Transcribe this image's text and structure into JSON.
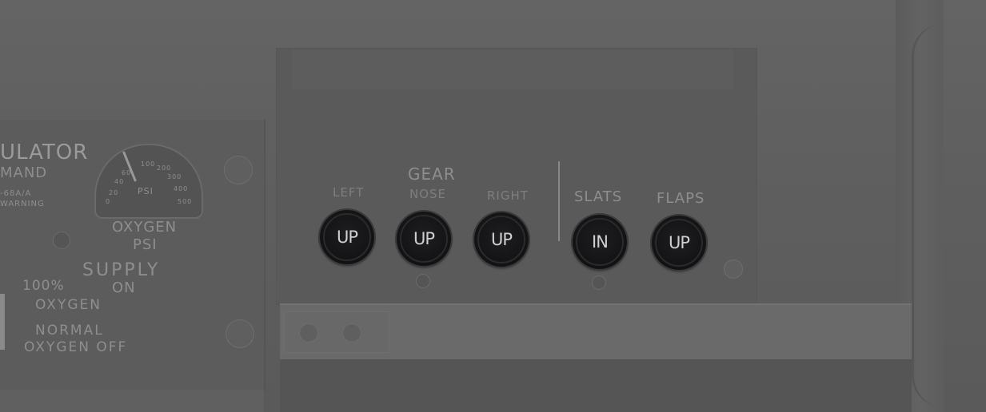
{
  "left_panel": {
    "regulator_title": "ULATOR",
    "regulator_subtitle": "MAND",
    "model_line": "-68A/A",
    "warning_line": "WARNING",
    "gauge": {
      "unit": "PSI",
      "scale": [
        "0",
        "20",
        "40",
        "60",
        "100",
        "200",
        "300",
        "400",
        "500"
      ]
    },
    "gauge_caption_1": "OXYGEN",
    "gauge_caption_2": "PSI",
    "supply_label": "SUPPLY",
    "supply_on": "ON",
    "oxygen_100": "100%",
    "oxygen_label": "OXYGEN",
    "normal_label": "NORMAL",
    "oxygen_off": "OXYGEN OFF"
  },
  "gear_panel": {
    "group_title": "GEAR",
    "indicators": [
      {
        "label": "LEFT",
        "value": "UP"
      },
      {
        "label": "NOSE",
        "value": "UP"
      },
      {
        "label": "RIGHT",
        "value": "UP"
      },
      {
        "label": "SLATS",
        "value": "IN"
      },
      {
        "label": "FLAPS",
        "value": "UP"
      }
    ]
  }
}
